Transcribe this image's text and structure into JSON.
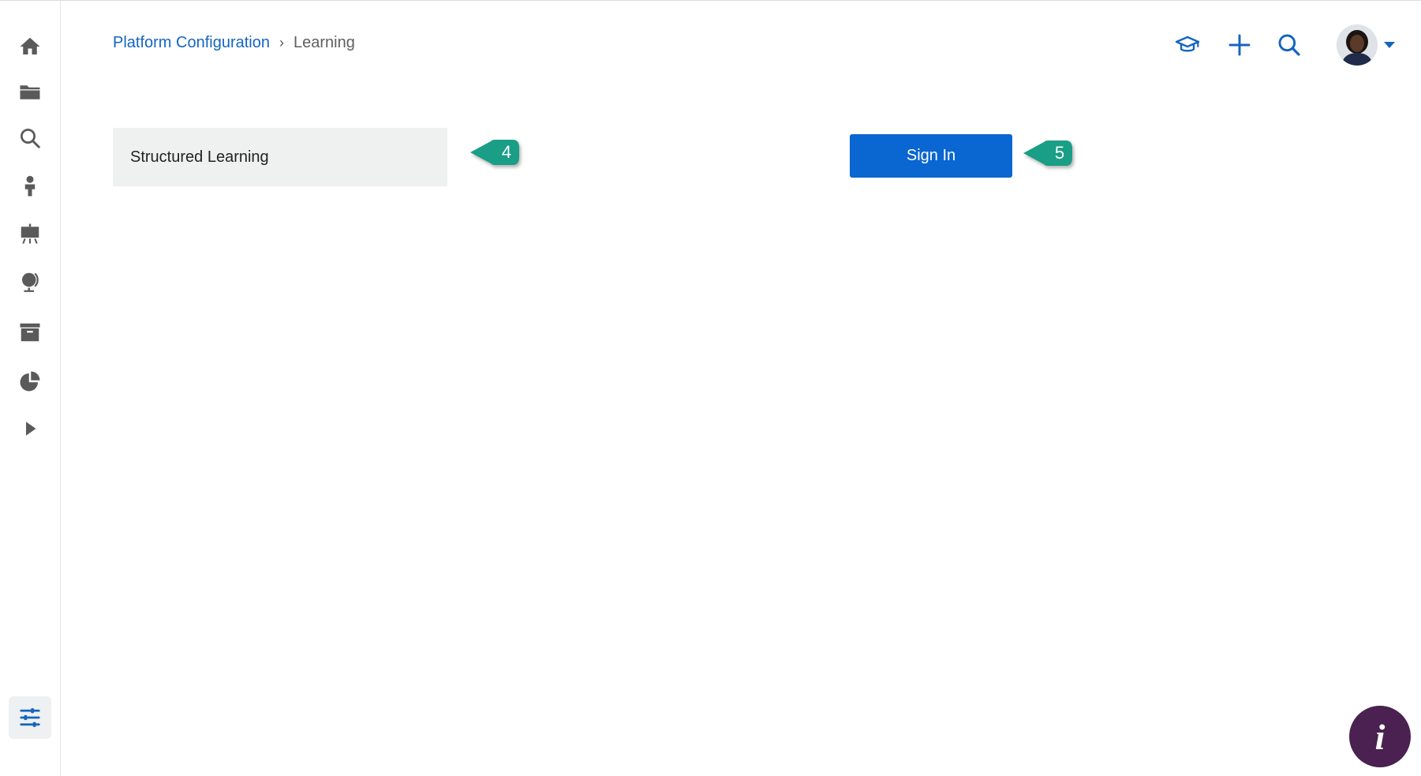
{
  "colors": {
    "accent": "#0a66d0",
    "link": "#1565c0",
    "nav_icon": "#5a5a5a",
    "callout": "#1a9e86",
    "info_fab": "#4a2150",
    "panel_bg": "#eff0f0"
  },
  "sidebar": {
    "items": [
      {
        "icon": "home-icon"
      },
      {
        "icon": "folder-icon"
      },
      {
        "icon": "search-icon"
      },
      {
        "icon": "person-icon"
      },
      {
        "icon": "presentation-board-icon"
      },
      {
        "icon": "globe-icon"
      },
      {
        "icon": "archive-box-icon"
      },
      {
        "icon": "pie-chart-icon"
      },
      {
        "icon": "play-arrow-icon"
      }
    ],
    "bottom_item": {
      "icon": "settings-sliders-icon",
      "active": true
    }
  },
  "breadcrumb": {
    "parent": "Platform Configuration",
    "separator": "›",
    "current": "Learning"
  },
  "header": {
    "actions": [
      {
        "icon": "graduation-cap-icon"
      },
      {
        "icon": "plus-icon"
      },
      {
        "icon": "search-icon"
      }
    ],
    "avatar": {
      "icon": "user-avatar"
    },
    "menu_caret": {
      "icon": "caret-down-icon"
    }
  },
  "content": {
    "structured_learning_label": "Structured Learning",
    "sign_in_label": "Sign In",
    "callouts": [
      {
        "number": "4"
      },
      {
        "number": "5"
      }
    ]
  },
  "info_button": {
    "label": "i"
  }
}
